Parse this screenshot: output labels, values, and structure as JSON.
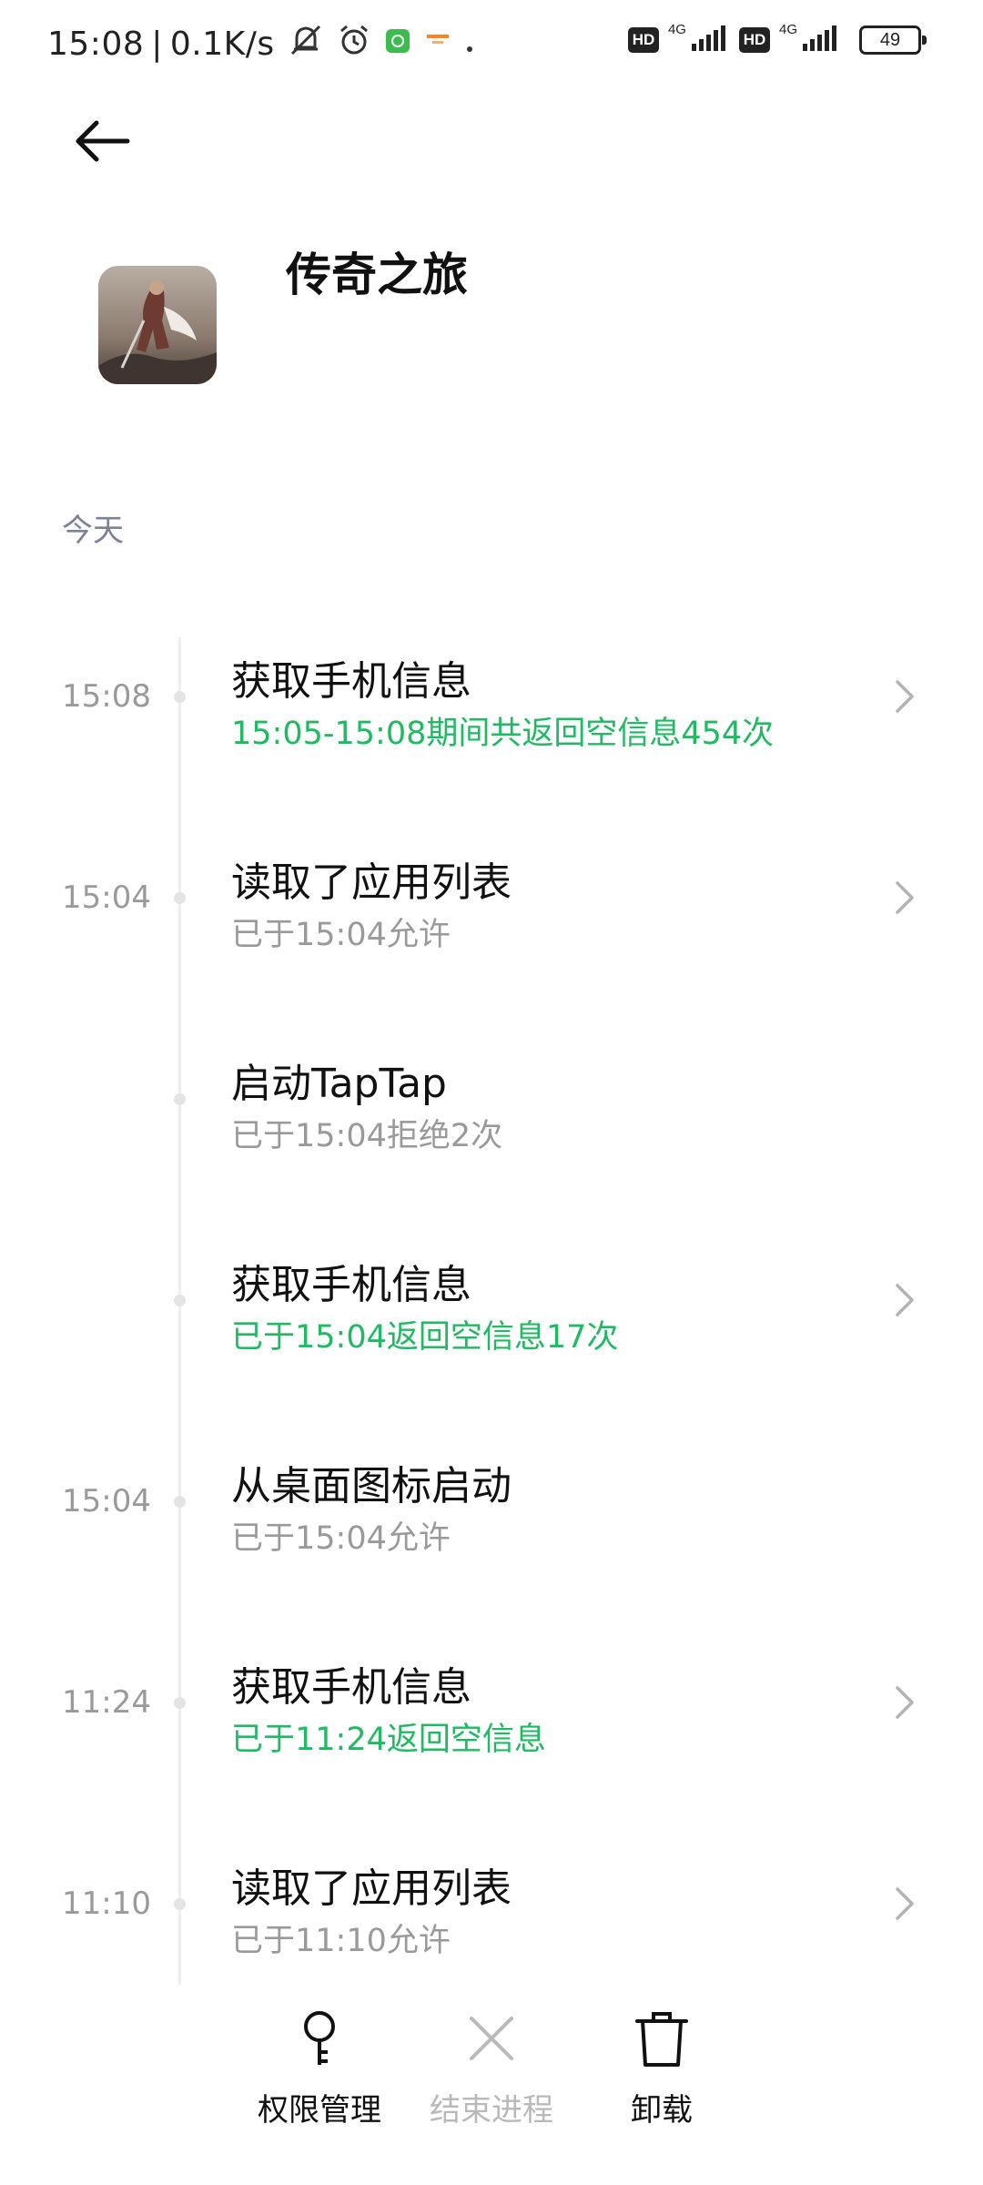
{
  "status_bar": {
    "time": "15:08",
    "separator": "|",
    "net_speed": "0.1K/s",
    "hd_label": "HD",
    "network_type": "4G",
    "battery_level": "49"
  },
  "header": {
    "app_name": "传奇之旅"
  },
  "section": {
    "label": "今天"
  },
  "entries": [
    {
      "time": "15:08",
      "title": "获取手机信息",
      "sub": "15:05-15:08期间共返回空信息454次",
      "sub_color": "green",
      "has_chevron": true
    },
    {
      "time": "15:04",
      "title": "读取了应用列表",
      "sub": "已于15:04允许",
      "sub_color": "gray",
      "has_chevron": true
    },
    {
      "time": "",
      "title": "启动TapTap",
      "sub": "已于15:04拒绝2次",
      "sub_color": "gray",
      "has_chevron": false
    },
    {
      "time": "",
      "title": "获取手机信息",
      "sub": "已于15:04返回空信息17次",
      "sub_color": "green",
      "has_chevron": true
    },
    {
      "time": "15:04",
      "title": "从桌面图标启动",
      "sub": "已于15:04允许",
      "sub_color": "gray",
      "has_chevron": false
    },
    {
      "time": "11:24",
      "title": "获取手机信息",
      "sub": "已于11:24返回空信息",
      "sub_color": "green",
      "has_chevron": true
    },
    {
      "time": "11:10",
      "title": "读取了应用列表",
      "sub": "已于11:10允许",
      "sub_color": "gray",
      "has_chevron": true
    }
  ],
  "bottom_bar": {
    "permissions_label": "权限管理",
    "end_process_label": "结束进程",
    "uninstall_label": "卸载"
  },
  "colors": {
    "green": "#1fba61",
    "gray_text": "#9a9a9a",
    "section_label": "#7a8496"
  }
}
